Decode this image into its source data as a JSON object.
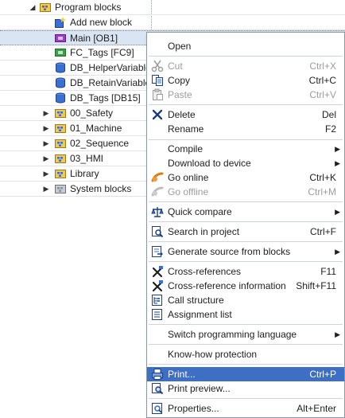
{
  "tree": {
    "items": [
      {
        "label": "Program blocks",
        "arrow": "◢",
        "icon": "folder-blocks-icon"
      },
      {
        "label": "Add new block",
        "arrow": "",
        "icon": "add-block-icon"
      },
      {
        "label": "Main [OB1]",
        "arrow": "",
        "icon": "ob-block-icon"
      },
      {
        "label": "FC_Tags [FC9]",
        "arrow": "",
        "icon": "fc-block-icon"
      },
      {
        "label": "DB_HelperVariables",
        "arrow": "",
        "icon": "db-block-icon"
      },
      {
        "label": "DB_RetainVariables",
        "arrow": "",
        "icon": "db-block-icon"
      },
      {
        "label": "DB_Tags [DB15]",
        "arrow": "",
        "icon": "db-block-icon"
      },
      {
        "label": "00_Safety",
        "arrow": "▶",
        "icon": "folder-blocks-icon"
      },
      {
        "label": "01_Machine",
        "arrow": "▶",
        "icon": "folder-blocks-icon"
      },
      {
        "label": "02_Sequence",
        "arrow": "▶",
        "icon": "folder-blocks-icon"
      },
      {
        "label": "03_HMI",
        "arrow": "▶",
        "icon": "folder-blocks-icon"
      },
      {
        "label": "Library",
        "arrow": "▶",
        "icon": "folder-blocks-icon"
      },
      {
        "label": "System blocks",
        "arrow": "▶",
        "icon": "folder-system-icon"
      }
    ]
  },
  "menu": {
    "open": {
      "label": "Open"
    },
    "cut": {
      "label": "Cut",
      "key": "Ctrl+X"
    },
    "copy": {
      "label": "Copy",
      "key": "Ctrl+C"
    },
    "paste": {
      "label": "Paste",
      "key": "Ctrl+V"
    },
    "delete": {
      "label": "Delete",
      "key": "Del"
    },
    "rename": {
      "label": "Rename",
      "key": "F2"
    },
    "compile": {
      "label": "Compile"
    },
    "download": {
      "label": "Download to device"
    },
    "go_online": {
      "label": "Go online",
      "key": "Ctrl+K"
    },
    "go_offline": {
      "label": "Go offline",
      "key": "Ctrl+M"
    },
    "quick_compare": {
      "label": "Quick compare"
    },
    "search": {
      "label": "Search in project",
      "key": "Ctrl+F"
    },
    "generate_source": {
      "label": "Generate source from blocks"
    },
    "cross_refs": {
      "label": "Cross-references",
      "key": "F11"
    },
    "cross_ref_info": {
      "label": "Cross-reference information",
      "key": "Shift+F11"
    },
    "call_structure": {
      "label": "Call structure"
    },
    "assignment_list": {
      "label": "Assignment list"
    },
    "switch_lang": {
      "label": "Switch programming language"
    },
    "knowhow": {
      "label": "Know-how protection"
    },
    "print": {
      "label": "Print...",
      "key": "Ctrl+P"
    },
    "print_preview": {
      "label": "Print preview..."
    },
    "properties": {
      "label": "Properties...",
      "key": "Alt+Enter"
    }
  },
  "colors": {
    "highlight": "#3d6fc4",
    "selection": "#d9e5f3"
  }
}
